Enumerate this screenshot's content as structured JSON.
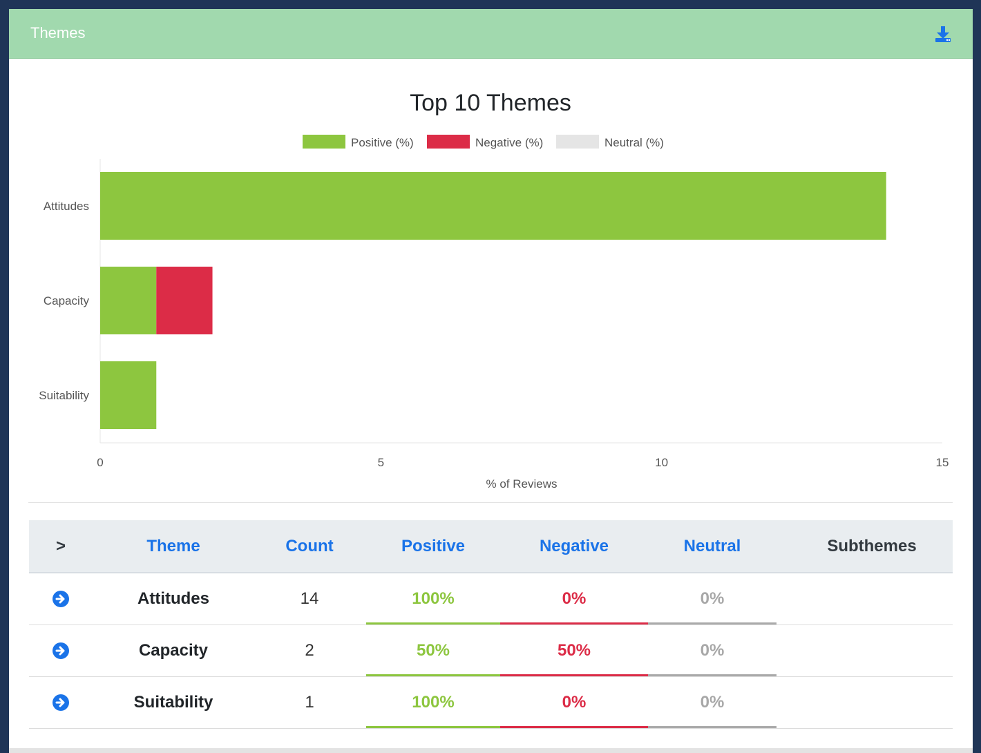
{
  "panel": {
    "title": "Themes",
    "download_icon": "download-icon"
  },
  "colors": {
    "header_bg": "#a1d9ae",
    "positive": "#8dc63f",
    "negative": "#dc2c47",
    "neutral": "#e5e5e5",
    "link_blue": "#1a73e8"
  },
  "chart_data": {
    "type": "bar",
    "orientation": "horizontal",
    "stacked": true,
    "title": "Top 10 Themes",
    "xlabel": "% of Reviews",
    "ylabel": "",
    "categories": [
      "Attitudes",
      "Capacity",
      "Suitability"
    ],
    "series": [
      {
        "name": "Positive (%)",
        "values": [
          14,
          1,
          1
        ],
        "color": "#8dc63f"
      },
      {
        "name": "Negative (%)",
        "values": [
          0,
          1,
          0
        ],
        "color": "#dc2c47"
      },
      {
        "name": "Neutral (%)",
        "values": [
          0,
          0,
          0
        ],
        "color": "#e5e5e5"
      }
    ],
    "xlim": [
      0,
      15
    ],
    "xticks": [
      "0",
      "5",
      "10",
      "15"
    ],
    "legend": "top-center",
    "grid": false
  },
  "table": {
    "headers": {
      "expand": ">",
      "theme": "Theme",
      "count": "Count",
      "positive": "Positive",
      "negative": "Negative",
      "neutral": "Neutral",
      "subthemes": "Subthemes"
    },
    "rows": [
      {
        "theme": "Attitudes",
        "count": "14",
        "positive": "100%",
        "negative": "0%",
        "neutral": "0%",
        "subthemes": ""
      },
      {
        "theme": "Capacity",
        "count": "2",
        "positive": "50%",
        "negative": "50%",
        "neutral": "0%",
        "subthemes": ""
      },
      {
        "theme": "Suitability",
        "count": "1",
        "positive": "100%",
        "negative": "0%",
        "neutral": "0%",
        "subthemes": ""
      }
    ]
  }
}
